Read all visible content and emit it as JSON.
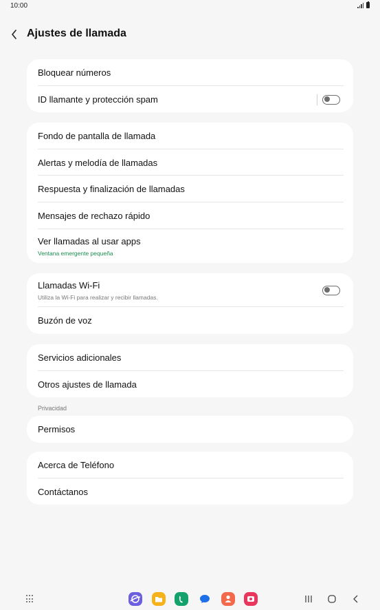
{
  "status_bar": {
    "time": "10:00"
  },
  "header": {
    "title": "Ajustes de llamada"
  },
  "cards": {
    "block": {
      "block_numbers": "Bloquear números",
      "caller_id": "ID llamante y protección spam",
      "caller_id_enabled": false
    },
    "call": {
      "wallpaper": "Fondo de pantalla de llamada",
      "alerts": "Alertas y melodía de llamadas",
      "answer_end": "Respuesta y finalización de llamadas",
      "reject_messages": "Mensajes de rechazo rápido",
      "show_calls": "Ver llamadas al usar apps",
      "show_calls_value": "Ventana emergente pequeña"
    },
    "wifi": {
      "wifi_calls": "Llamadas Wi-Fi",
      "wifi_calls_sub": "Utiliza la Wi-Fi para realizar y recibir llamadas.",
      "wifi_calls_enabled": false,
      "voicemail": "Buzón de voz"
    },
    "extra": {
      "additional": "Servicios adicionales",
      "other": "Otros ajustes de llamada"
    },
    "privacy_title": "Privacidad",
    "privacy": {
      "permissions": "Permisos"
    },
    "about": {
      "about_phone": "Acerca de Teléfono",
      "contact": "Contáctanos"
    }
  },
  "nav_bar": {
    "dock_apps": [
      {
        "icon": "internet-app-icon",
        "color": "#6b5fe0"
      },
      {
        "icon": "my-files-app-icon",
        "color": "#f5b21b"
      },
      {
        "icon": "phone-app-icon",
        "color": "#13a26b"
      },
      {
        "icon": "messages-app-icon",
        "color": "#1d6fe8"
      },
      {
        "icon": "contacts-app-icon",
        "color": "#f26a4b"
      },
      {
        "icon": "screen-recorder-app-icon",
        "color": "#e8365d"
      }
    ]
  }
}
